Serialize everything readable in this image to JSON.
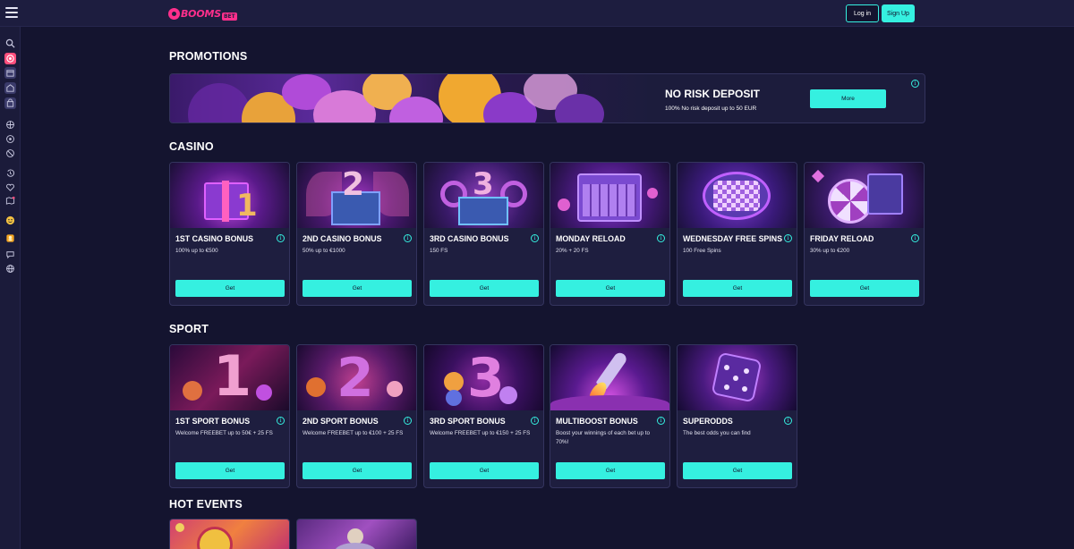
{
  "header": {
    "logo_text": "BOOMS",
    "logo_suffix": "BET",
    "login_label": "Log in",
    "signup_label": "Sign Up"
  },
  "sidebar": {
    "icons": [
      "search-icon",
      "target-icon",
      "calendar-icon",
      "shop-icon",
      "bag-icon",
      "globe-ball-icon",
      "soccer-ball-icon",
      "basketball-icon",
      "history-icon",
      "heart-icon",
      "map-icon",
      "emoji-icon",
      "gift-icon",
      "chat-icon",
      "language-icon"
    ]
  },
  "promotions": {
    "title": "PROMOTIONS",
    "banner": {
      "title": "NO RISK DEPOSIT",
      "subtitle": "100% No risk deposit up to 50 EUR",
      "button_label": "More"
    }
  },
  "casino": {
    "title": "CASINO",
    "cards": [
      {
        "title": "1ST CASINO BONUS",
        "subtitle": "100% up to €500",
        "button_label": "Get",
        "art": "1"
      },
      {
        "title": "2ND CASINO BONUS",
        "subtitle": "50% up to €1000",
        "button_label": "Get",
        "art": "2"
      },
      {
        "title": "3RD CASINO BONUS",
        "subtitle": "150 FS",
        "button_label": "Get",
        "art": "3"
      },
      {
        "title": "MONDAY RELOAD",
        "subtitle": "20% + 20 FS",
        "button_label": "Get",
        "art": "calendar"
      },
      {
        "title": "WEDNESDAY FREE SPINS",
        "subtitle": "100 Free Spins",
        "button_label": "Get",
        "art": "calendar2"
      },
      {
        "title": "FRIDAY RELOAD",
        "subtitle": "30% up to €200",
        "button_label": "Get",
        "art": "roulette"
      }
    ]
  },
  "sport": {
    "title": "SPORT",
    "cards": [
      {
        "title": "1ST SPORT BONUS",
        "subtitle": "Welcome FREEBET up to 50€ + 25 FS",
        "button_label": "Get",
        "art": "1"
      },
      {
        "title": "2ND SPORT BONUS",
        "subtitle": "Welcome FREEBET up to €100 + 25 FS",
        "button_label": "Get",
        "art": "2"
      },
      {
        "title": "3RD SPORT BONUS",
        "subtitle": "Welcome FREEBET up to €150 + 25 FS",
        "button_label": "Get",
        "art": "3"
      },
      {
        "title": "MULTIBOOST BONUS",
        "subtitle": "Boost your winnings of each bet up to 70%!",
        "button_label": "Get",
        "art": "rocket"
      },
      {
        "title": "SUPERODDS",
        "subtitle": "The best odds you can find",
        "button_label": "Get",
        "art": "dice"
      }
    ]
  },
  "hot_events": {
    "title": "HOT EVENTS"
  },
  "colors": {
    "accent": "#35f0e0",
    "brand": "#ff2f8c",
    "background": "#14142f",
    "card": "#1e1e3f"
  }
}
